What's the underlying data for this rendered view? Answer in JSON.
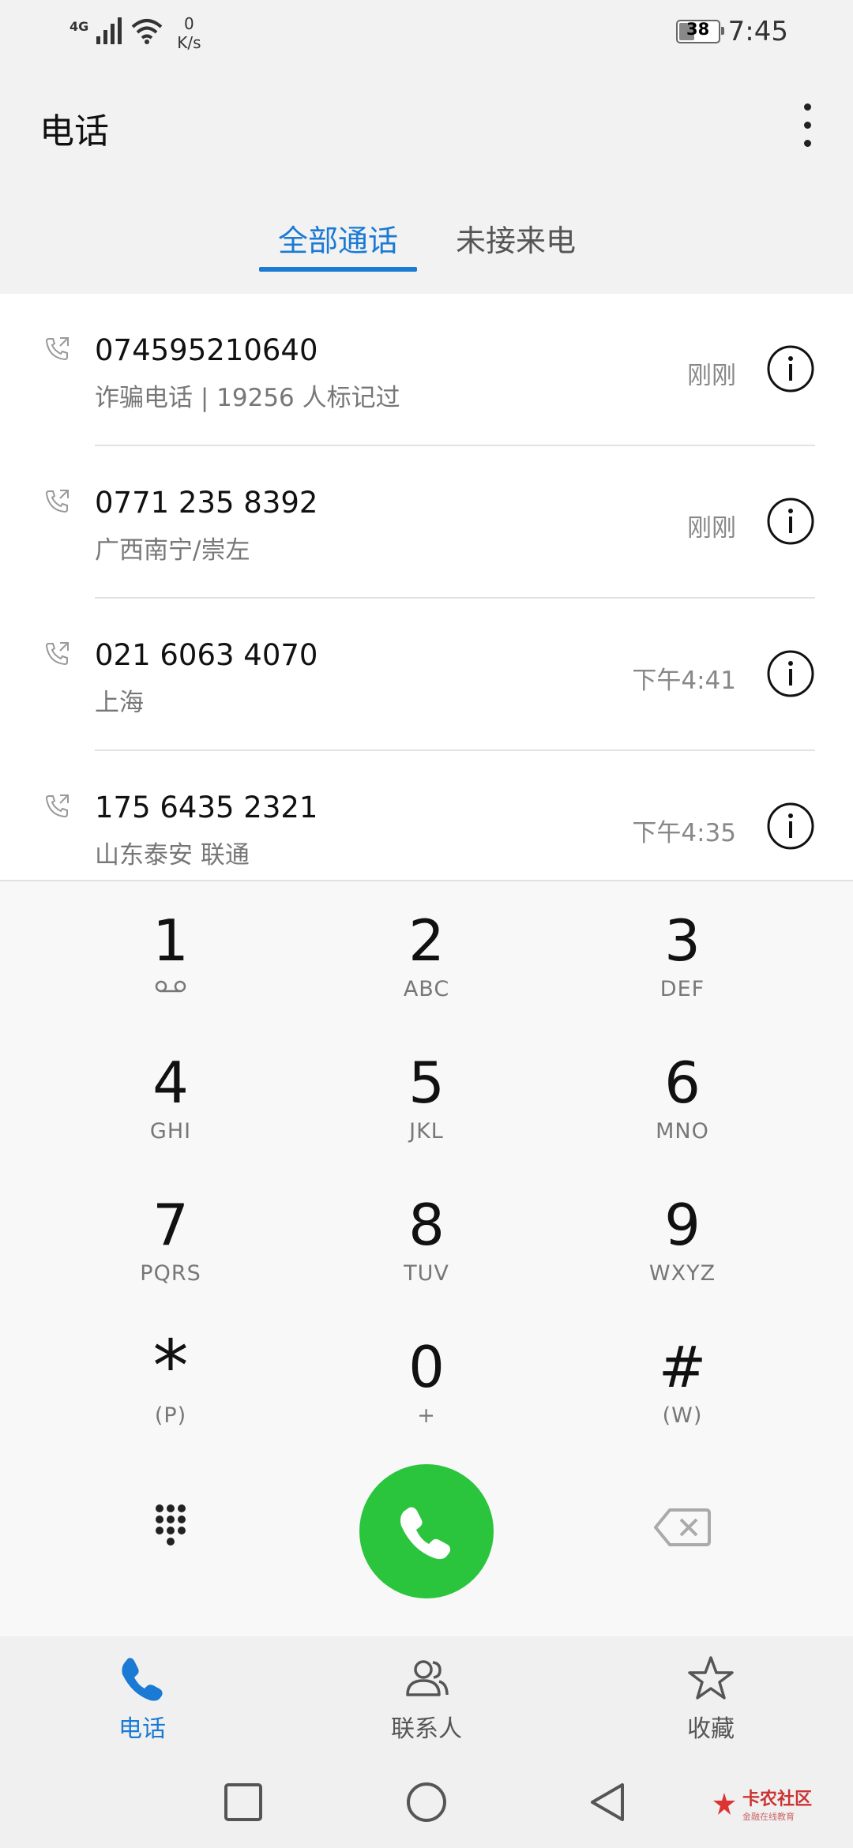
{
  "status_bar": {
    "network": "4G",
    "speed_value": "0",
    "speed_unit": "K/s",
    "battery": "38",
    "battery_level": 0.38,
    "time": "7:45"
  },
  "header": {
    "title": "电话",
    "menu_icon": "more-vertical-icon"
  },
  "tabs": [
    {
      "label": "全部通话",
      "active": true
    },
    {
      "label": "未接来电",
      "active": false
    }
  ],
  "calls": [
    {
      "number": "074595210640",
      "detail": "诈骗电话 | 19256 人标记过",
      "time": "刚刚"
    },
    {
      "number": "0771 235 8392",
      "detail": "广西南宁/崇左",
      "time": "刚刚"
    },
    {
      "number": "021 6063 4070",
      "detail": "上海",
      "time": "下午4:41"
    },
    {
      "number": "175 6435 2321",
      "detail": "山东泰安 联通",
      "time": "下午4:35"
    }
  ],
  "dialpad": {
    "keys": [
      {
        "digit": "1",
        "letters": ""
      },
      {
        "digit": "2",
        "letters": "ABC"
      },
      {
        "digit": "3",
        "letters": "DEF"
      },
      {
        "digit": "4",
        "letters": "GHI"
      },
      {
        "digit": "5",
        "letters": "JKL"
      },
      {
        "digit": "6",
        "letters": "MNO"
      },
      {
        "digit": "7",
        "letters": "PQRS"
      },
      {
        "digit": "8",
        "letters": "TUV"
      },
      {
        "digit": "9",
        "letters": "WXYZ"
      },
      {
        "digit": "*",
        "letters": "(P)"
      },
      {
        "digit": "0",
        "letters": "+"
      },
      {
        "digit": "#",
        "letters": "(W)"
      }
    ],
    "call_button_color": "#2bc43d"
  },
  "bottom_nav": {
    "phone": "电话",
    "contacts": "联系人",
    "favorites": "收藏",
    "active_color": "#1a7ad4"
  },
  "watermark": {
    "text": "卡农社区",
    "sub": "金融在线教育"
  }
}
